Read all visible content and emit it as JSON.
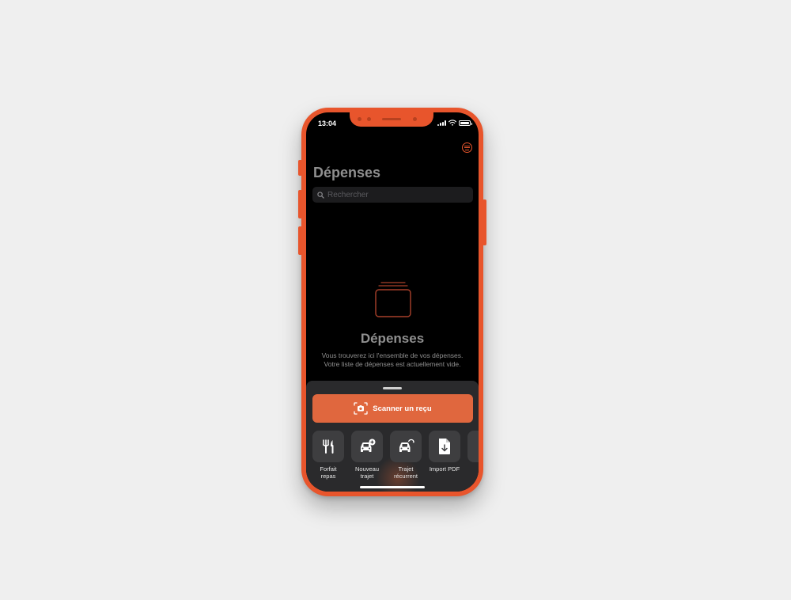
{
  "status_bar": {
    "time": "13:04"
  },
  "header": {
    "title": "Dépenses",
    "menu_icon": "list-circle-icon"
  },
  "search": {
    "placeholder": "Rechercher",
    "icon": "search-icon"
  },
  "empty_state": {
    "icon": "folder-stack-icon",
    "title": "Dépenses",
    "description_line1": "Vous trouverez ici l'ensemble de vos dépenses.",
    "description_line2": "Votre liste de dépenses est actuellement vide."
  },
  "bottom_sheet": {
    "scan_button": {
      "label": "Scanner un reçu",
      "icon": "camera-scan-icon"
    },
    "actions": [
      {
        "label": "Forfait\nrepas",
        "icon": "fork-knife-icon"
      },
      {
        "label": "Nouveau\ntrajet",
        "icon": "car-plus-icon"
      },
      {
        "label": "Trajet\nrécurrent",
        "icon": "car-repeat-icon"
      },
      {
        "label": "Import PDF",
        "icon": "pdf-download-icon"
      }
    ]
  },
  "colors": {
    "accent": "#e8552c",
    "button": "#e0673e",
    "background": "#000000",
    "sheet": "#2a2a2c",
    "text_secondary": "#8f8f8f"
  }
}
